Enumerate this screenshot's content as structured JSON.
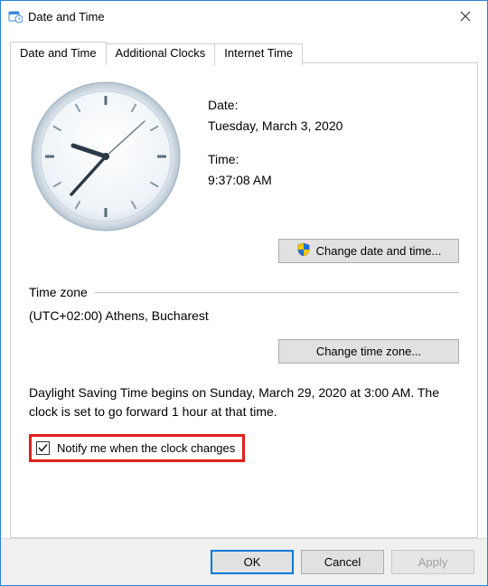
{
  "window": {
    "title": "Date and Time"
  },
  "tabs": [
    {
      "label": "Date and Time"
    },
    {
      "label": "Additional Clocks"
    },
    {
      "label": "Internet Time"
    }
  ],
  "datetime": {
    "date_label": "Date:",
    "date_value": "Tuesday, March 3, 2020",
    "time_label": "Time:",
    "time_value": "9:37:08 AM",
    "change_button": "Change date and time..."
  },
  "timezone": {
    "section_label": "Time zone",
    "value": "(UTC+02:00) Athens, Bucharest",
    "change_button": "Change time zone..."
  },
  "dst": {
    "text": "Daylight Saving Time begins on Sunday, March 29, 2020 at 3:00 AM. The clock is set to go forward 1 hour at that time.",
    "notify_label": "Notify me when the clock changes",
    "notify_checked": true
  },
  "buttons": {
    "ok": "OK",
    "cancel": "Cancel",
    "apply": "Apply"
  }
}
